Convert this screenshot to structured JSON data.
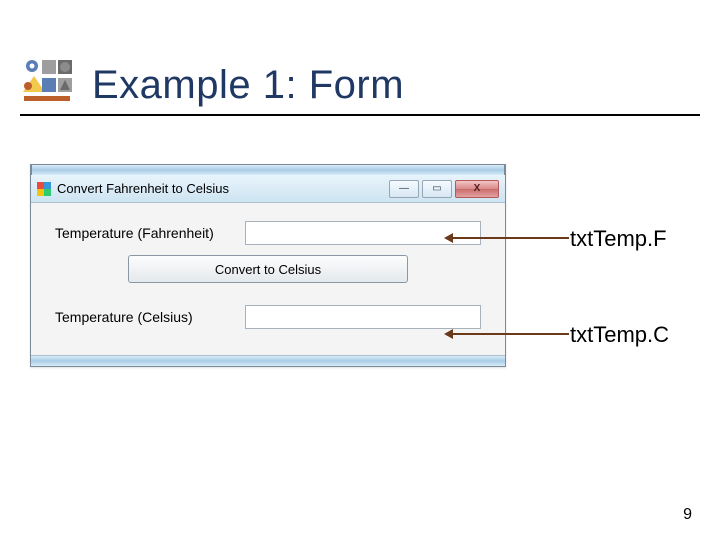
{
  "header": {
    "title": "Example 1: Form"
  },
  "window": {
    "title": "Convert Fahrenheit to Celsius",
    "controls": {
      "minimize_glyph": "—",
      "maximize_glyph": "▭",
      "close_glyph": "X"
    },
    "rows": {
      "fahrenheit_label": "Temperature (Fahrenheit)",
      "celsius_label": "Temperature (Celsius)"
    },
    "inputs": {
      "txtTempF_value": "",
      "txtTempC_value": ""
    },
    "button_label": "Convert to Celsius"
  },
  "annotations": {
    "txtTempF": "txtTemp.F",
    "txtTempC": "txtTemp.C"
  },
  "page_number": "9"
}
